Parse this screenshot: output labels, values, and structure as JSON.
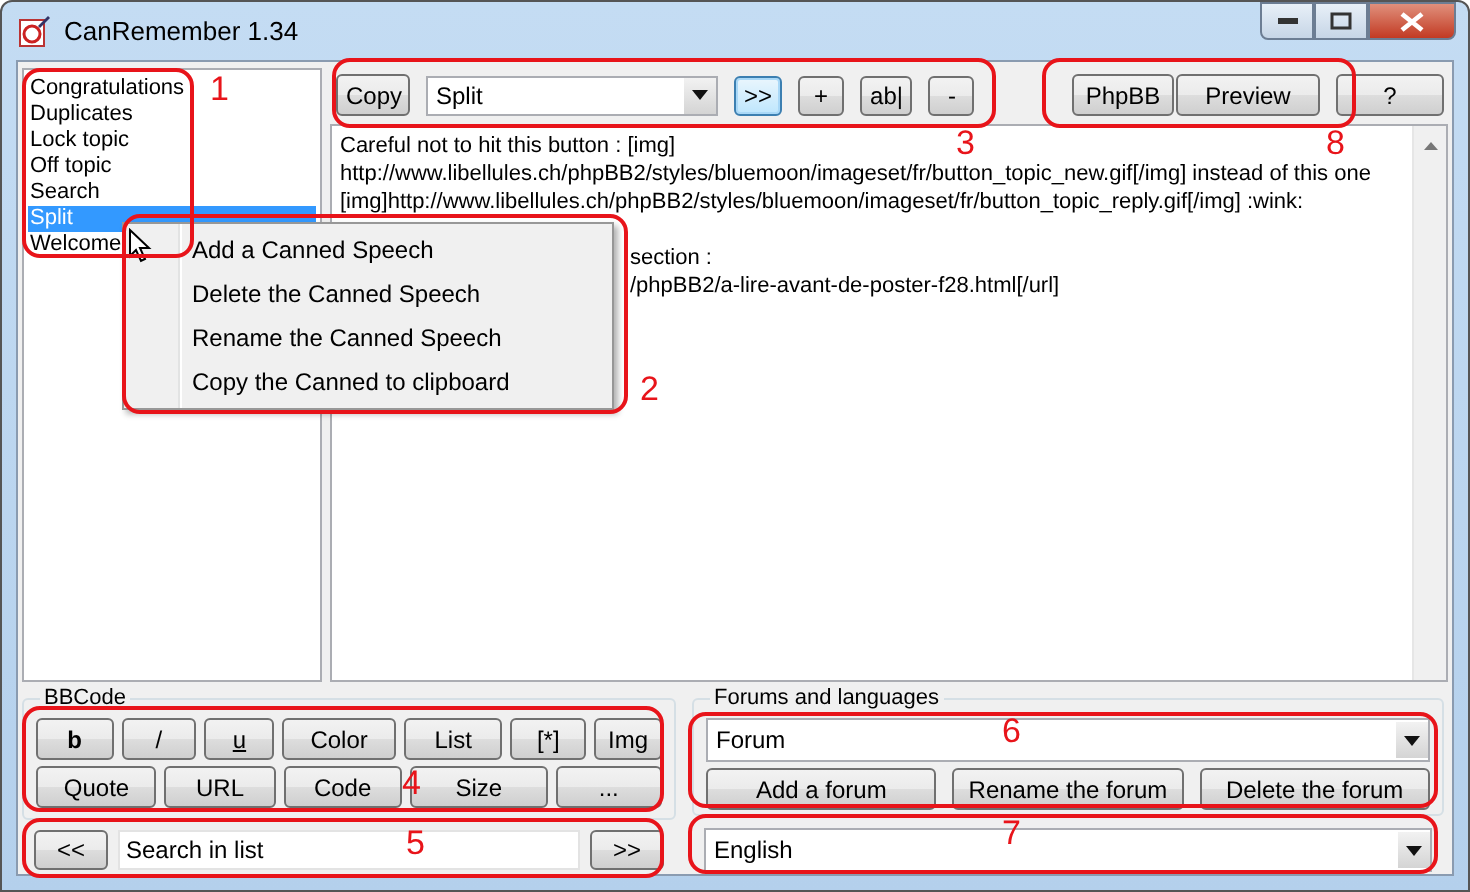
{
  "window": {
    "title": "CanRemember 1.34"
  },
  "speeches": [
    {
      "label": "Congratulations",
      "selected": false
    },
    {
      "label": "Duplicates",
      "selected": false
    },
    {
      "label": "Lock topic",
      "selected": false
    },
    {
      "label": "Off topic",
      "selected": false
    },
    {
      "label": "Search",
      "selected": false
    },
    {
      "label": "Split",
      "selected": true
    },
    {
      "label": "Welcome",
      "selected": false
    }
  ],
  "toolbar": {
    "copy_button": "Copy",
    "speech_select": "Split",
    "buttons": [
      {
        "label": ">>",
        "focused": true
      },
      {
        "label": "+",
        "focused": false
      },
      {
        "label": "ab|",
        "focused": false
      },
      {
        "label": "-",
        "focused": false
      }
    ],
    "right_buttons": [
      "PhpBB",
      "Preview",
      "?"
    ]
  },
  "editor": {
    "paragraphs": [
      {
        "obscured": false,
        "lines": [
          "Careful not to hit this button : [img]",
          "http://www.libellules.ch/phpBB2/styles/bluemoon/imageset/fr/button_topic_new.gif[/img] instead of this one",
          "[img]http://www.libellules.ch/phpBB2/styles/bluemoon/imageset/fr/button_topic_reply.gif[/img]  :wink:"
        ]
      },
      {
        "obscured": true,
        "lines": [
          "section :",
          "/phpBB2/a-lire-avant-de-poster-f28.html[/url]"
        ]
      }
    ]
  },
  "context_menu": {
    "items": [
      "Add a Canned Speech",
      "Delete the Canned Speech",
      "Rename the Canned Speech",
      "Copy the Canned to clipboard"
    ]
  },
  "bbcode": {
    "title": "BBCode",
    "upper_buttons": [
      {
        "label": "b",
        "kind": "bold"
      },
      {
        "label": "/",
        "kind": "plain"
      },
      {
        "label": "u",
        "kind": "underline"
      },
      {
        "label": "Color",
        "kind": "plain"
      },
      {
        "label": "List",
        "kind": "plain"
      },
      {
        "label": "[*]",
        "kind": "plain"
      },
      {
        "label": "Img",
        "kind": "plain"
      }
    ],
    "lower_buttons": [
      "Quote",
      "URL",
      "Code",
      "Size",
      "..."
    ]
  },
  "search": {
    "prev": "<<",
    "value": "Search in list",
    "next": ">>"
  },
  "forums": {
    "title": "Forums and languages",
    "forum_select": "Forum",
    "buttons": [
      "Add a forum",
      "Rename the forum",
      "Delete the forum"
    ],
    "language_select": "English"
  },
  "annotations": [
    {
      "label": "1"
    },
    {
      "label": "2"
    },
    {
      "label": "3"
    },
    {
      "label": "4"
    },
    {
      "label": "5"
    },
    {
      "label": "6"
    },
    {
      "label": "7"
    },
    {
      "label": "8"
    }
  ]
}
